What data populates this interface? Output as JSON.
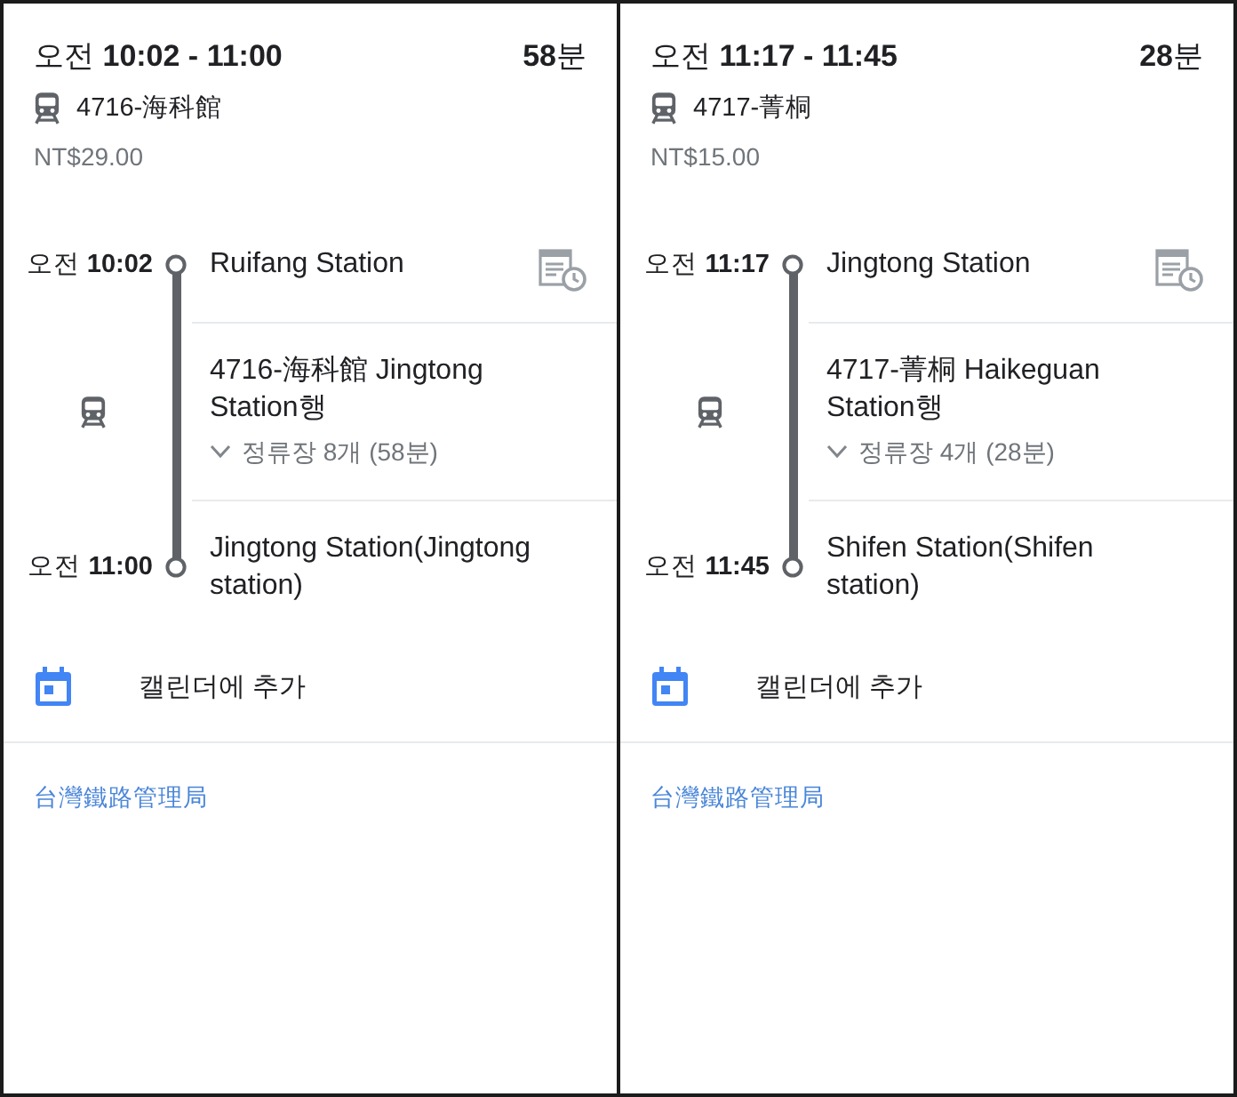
{
  "trips": [
    {
      "time_range": "오전 **10:02 - 11:00**",
      "duration": "**58**분",
      "line": "4716-海科館",
      "fare": "NT$29.00",
      "departure": {
        "time": "오전 **10:02**",
        "station": "Ruifang Station"
      },
      "ride": {
        "direction": "4716-海科館 Jingtong Station행",
        "stops_summary": "정류장 8개 (58분)",
        "expanded": false
      },
      "arrival": {
        "time": "오전 **11:00**",
        "station": "Jingtong Station(Jingtong station)"
      },
      "calendar_action": "캘린더에 추가",
      "agency": "台灣鐵路管理局"
    },
    {
      "time_range": "오전 **11:17 - 11:45**",
      "duration": "**28**분",
      "line": "4717-菁桐",
      "fare": "NT$15.00",
      "departure": {
        "time": "오전 **11:17**",
        "station": "Jingtong Station"
      },
      "ride": {
        "direction": "4717-菁桐 Haikeguan Station행",
        "stops_summary": "정류장 4개 (28분)",
        "expanded": false
      },
      "arrival": {
        "time": "오전 **11:45**",
        "station": "Shifen Station(Shifen station)"
      },
      "calendar_action": "캘린더에 추가",
      "agency": "台灣鐵路管理局"
    }
  ]
}
